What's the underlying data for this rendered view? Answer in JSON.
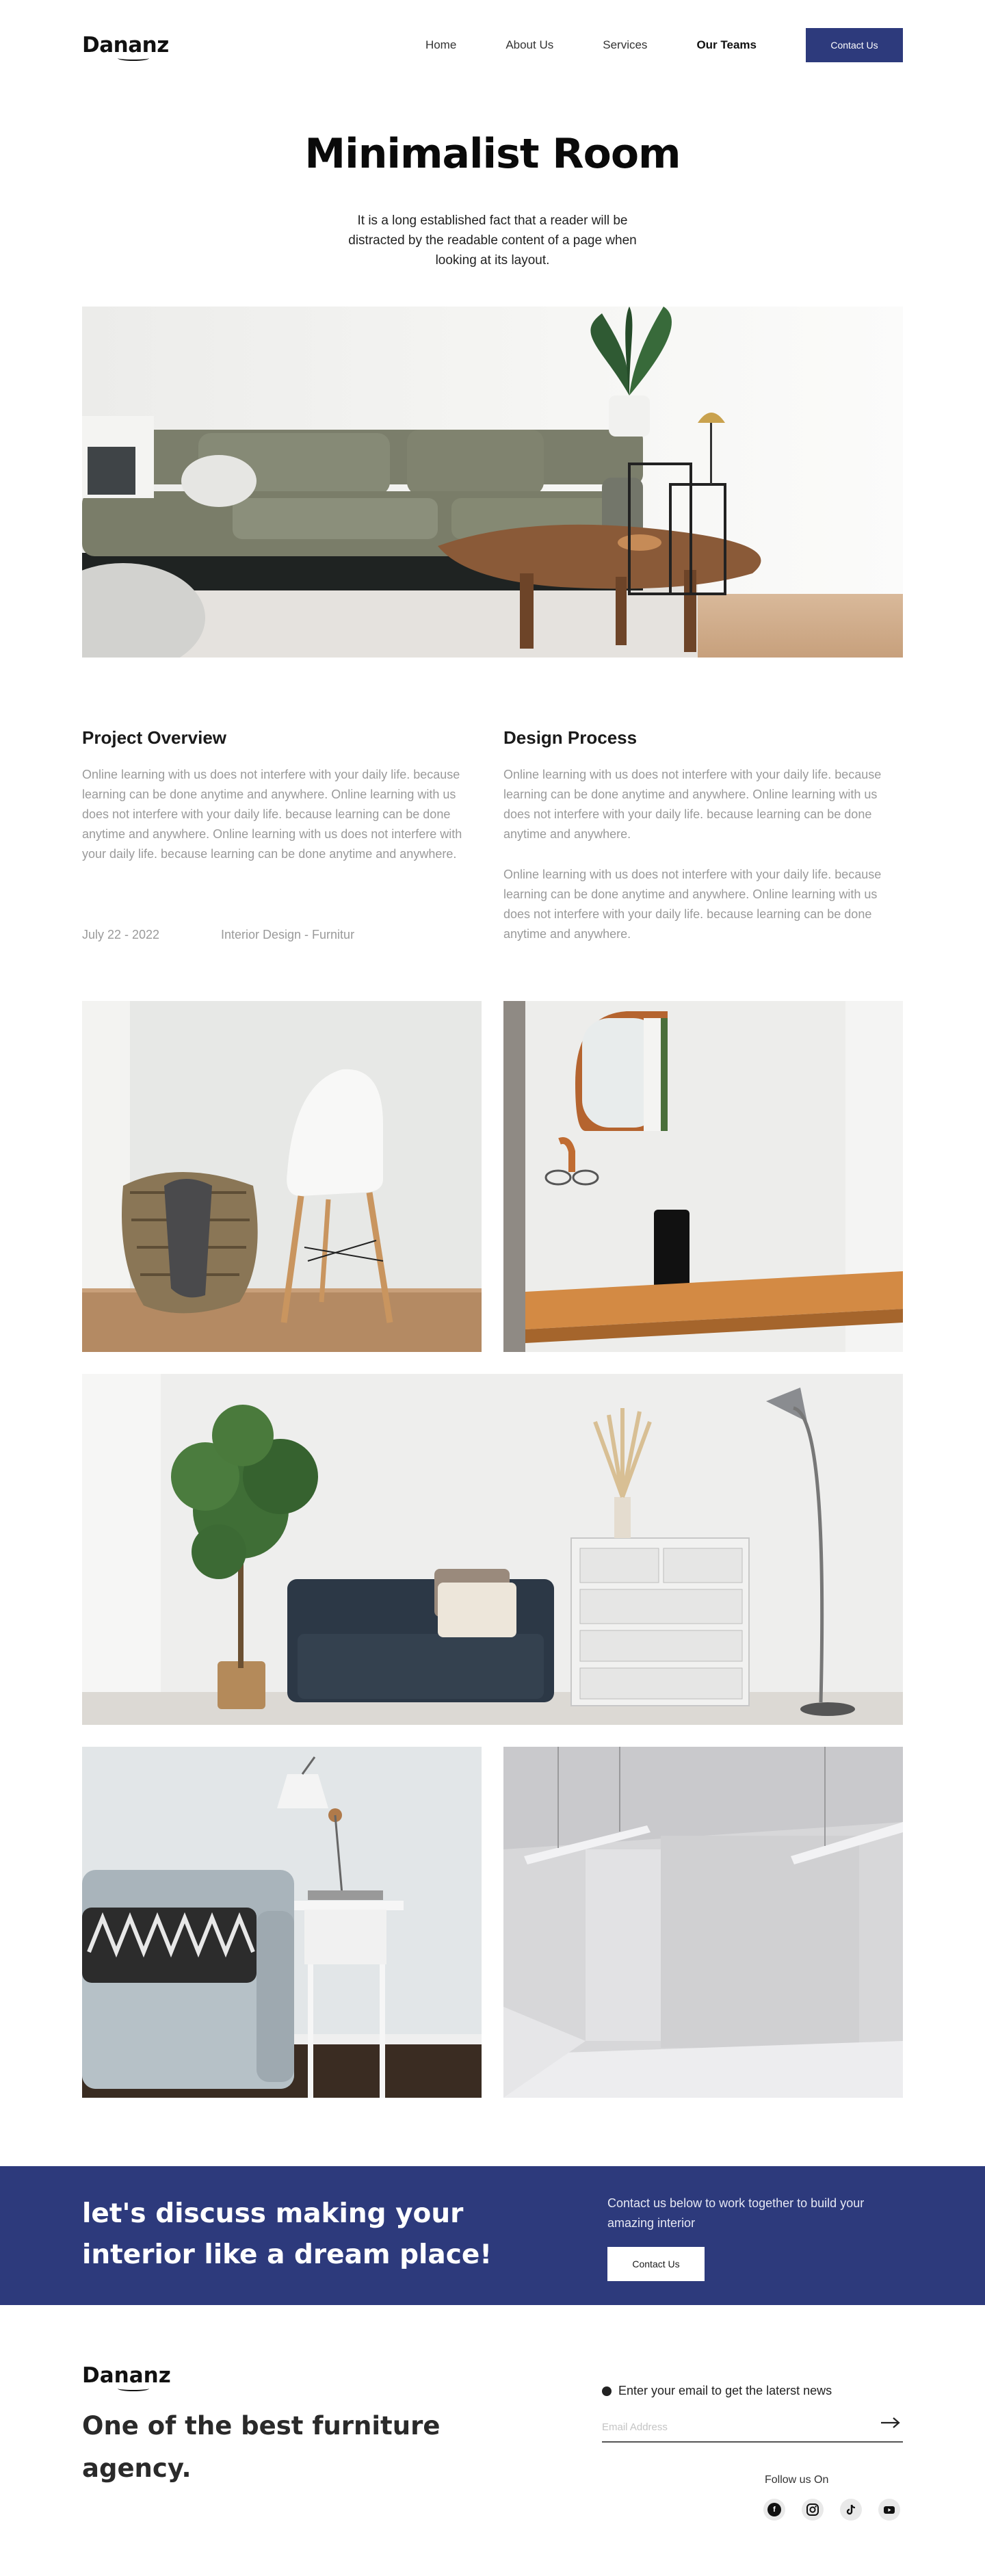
{
  "brand": {
    "name": "Dananz"
  },
  "nav": {
    "links": [
      "Home",
      "About Us",
      "Services",
      "Our Teams"
    ],
    "active": "Our Teams",
    "contact_label": "Contact Us"
  },
  "hero": {
    "title": "Minimalist Room",
    "description": "It is a long established fact that a reader will be distracted by the readable content of a page when looking at its layout."
  },
  "overview": {
    "title": "Project Overview",
    "text": "Online learning with us does not interfere with your daily life. because learning can be done anytime and anywhere. Online learning with us does not interfere with your daily life. because learning can be done anytime and anywhere. Online learning with us does not interfere with your daily life. because learning can be done anytime and anywhere.",
    "date": "July 22 - 2022",
    "category": "Interior Design - Furnitur"
  },
  "process": {
    "title": "Design Process",
    "paragraphs": [
      "Online learning with us does not interfere with your daily life. because learning can be done anytime and anywhere. Online learning with us does not interfere with your daily life. because learning can be done anytime and anywhere.",
      "Online learning with us does not interfere with your daily life. because learning can be done anytime and anywhere. Online learning with us does not interfere with your daily life. because learning can be done anytime and anywhere."
    ]
  },
  "cta": {
    "headline": "let's discuss making your interior like a dream place!",
    "text": "Contact us below to work together to build your amazing interior",
    "button": "Contact Us"
  },
  "footer": {
    "brand": "Dananz",
    "tagline": "One of the best furniture agency.",
    "newsletter_label": "Enter  your email to get the laterst news",
    "email_placeholder": "Email Address",
    "follow_label": "Follow us On",
    "socials": [
      "facebook-icon",
      "instagram-icon",
      "tiktok-icon",
      "youtube-icon"
    ]
  },
  "colors": {
    "primary": "#2d3a7c",
    "muted_text": "#9a9a9a"
  }
}
